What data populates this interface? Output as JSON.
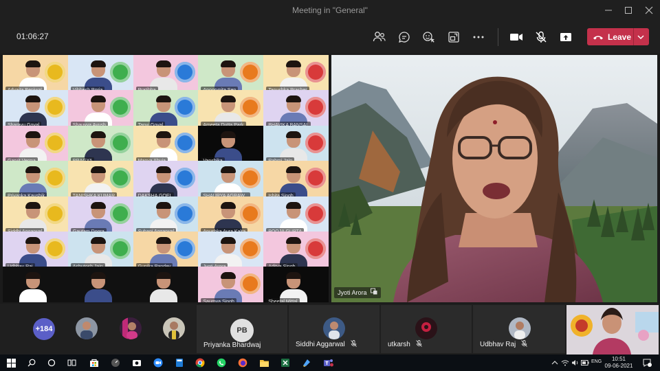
{
  "window": {
    "title": "Meeting in \"General\"",
    "controls": [
      "minimize-icon",
      "maximize-icon",
      "close-icon"
    ]
  },
  "toolbar": {
    "timer": "01:06:27",
    "buttons": [
      "participants-icon",
      "chat-icon",
      "reactions-icon",
      "breakout-rooms-icon",
      "more-options-icon",
      "camera-icon",
      "mic-muted-icon",
      "share-screen-icon"
    ],
    "leave_label": "Leave"
  },
  "grid": {
    "participants": [
      "Advaita Beniwal",
      "Vibhesh Poria",
      "Pratibha",
      "Apoorvnita Sen",
      "Tanushka Prasher",
      "Sharayu Goyal",
      "Shauvya Ayush",
      "Tanvi Goyal",
      "Ameeta Dutta Park",
      "BHAVIKA BANSAL",
      "Garvit Verma",
      "PRAGYA",
      "Manya Ahuja",
      "Vanshika",
      "Rahmi Jain",
      "Priyanka Kaushik",
      "TANISHKA KUMAR",
      "DAKSHA GOEL",
      "SHAURYA AGRAW...",
      "Ishita Singh",
      "Siddhi Aggarwal",
      "Gautam Dogra",
      "Suhani Aggarwal",
      "Anushka Aura Kalra",
      "POOJA GUPTA",
      "Udbhav Raj",
      "Ashutosh Jain",
      "Gunika Pandey",
      "Jyoti Arora",
      "Aditya Singh",
      "",
      "",
      "",
      "Saumya Singh",
      "Sheetal Mittal"
    ]
  },
  "speaker": {
    "name": "Jyoti Arora",
    "status_icon": "presenter-icon"
  },
  "gallery": {
    "more_count": "+184",
    "tiles": [
      {
        "name": "Priyanka Bhardwaj",
        "initials": "PB",
        "muted": false
      },
      {
        "name": "Siddhi Aggarwal",
        "muted": true
      },
      {
        "name": "utkarsh",
        "muted": true
      },
      {
        "name": "Udbhav Raj",
        "muted": true
      }
    ]
  },
  "taskbar": {
    "lang": "ENG",
    "time": "10:51",
    "date": "09-06-2021"
  },
  "colors": {
    "leave": "#c4314b",
    "teams_accent": "#5b5fc7",
    "background": "#1f1f1f"
  }
}
